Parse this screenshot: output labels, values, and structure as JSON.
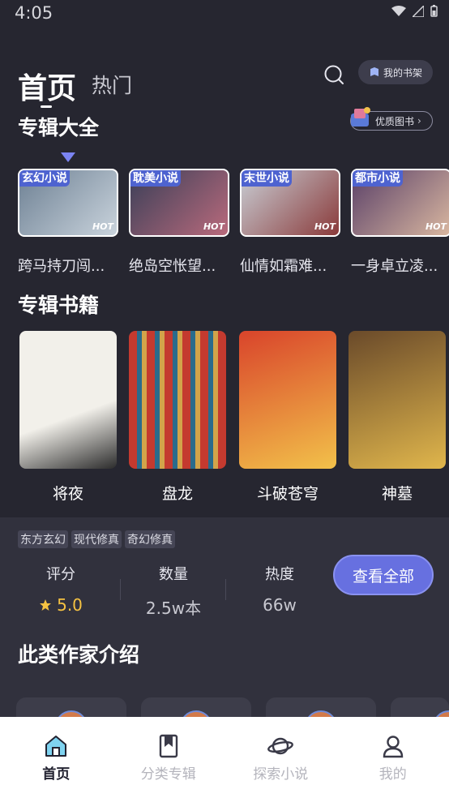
{
  "status": {
    "time": "4:05"
  },
  "header": {
    "tab_home": "首页",
    "tab_hot": "热门",
    "shelf_label": "我的书架"
  },
  "sections": {
    "albums_title": "专辑大全",
    "quality_label": "优质图书",
    "books_title": "专辑书籍",
    "authors_title": "此类作家介绍"
  },
  "albums": [
    {
      "genre": "玄幻小说",
      "hot": "HOT",
      "name": "跨马持刀闯...",
      "color_a": "#6e8194",
      "color_b": "#c9d3dc"
    },
    {
      "genre": "耽美小说",
      "hot": "HOT",
      "name": "绝岛空怅望...",
      "color_a": "#3a3f58",
      "color_b": "#b96a7c"
    },
    {
      "genre": "末世小说",
      "hot": "HOT",
      "name": "仙情如霜难...",
      "color_a": "#c9cfd6",
      "color_b": "#8a3a3a"
    },
    {
      "genre": "都市小说",
      "hot": "HOT",
      "name": "一身卓立凌...",
      "color_a": "#5a4068",
      "color_b": "#d9b7a0"
    }
  ],
  "books": [
    {
      "title": "将夜",
      "cover_a": "#f2f0ea",
      "cover_b": "#2c2c2c"
    },
    {
      "title": "盘龙",
      "cover_a": "#c43a2f",
      "cover_b": "#2a6b8c"
    },
    {
      "title": "斗破苍穹",
      "cover_a": "#d9442b",
      "cover_b": "#f2c14a"
    },
    {
      "title": "神墓",
      "cover_a": "#6a4a2a",
      "cover_b": "#e0b64c"
    }
  ],
  "info": {
    "tags": [
      "东方玄幻",
      "现代修真",
      "奇幻修真"
    ],
    "rating_label": "评分",
    "rating_value": "5.0",
    "count_label": "数量",
    "count_value": "2.5w本",
    "heat_label": "热度",
    "heat_value": "66w",
    "view_all": "查看全部"
  },
  "nav": {
    "home": "首页",
    "category": "分类专辑",
    "explore": "探索小说",
    "mine": "我的"
  },
  "colors": {
    "background": "#262630",
    "accent": "#6770e0",
    "rating_star": "#f5c242"
  }
}
